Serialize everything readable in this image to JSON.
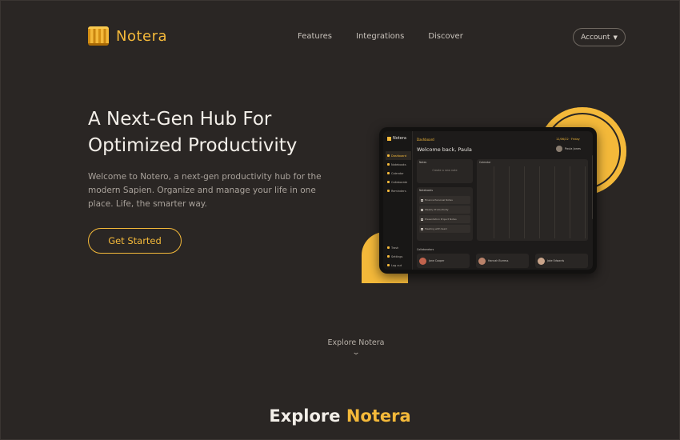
{
  "nav": {
    "brand": "Notera",
    "links": [
      "Features",
      "Integrations",
      "Discover"
    ],
    "account_label": "Account"
  },
  "hero": {
    "title_line1": "A Next-Gen Hub For",
    "title_line2": "Optimized Productivity",
    "description": "Welcome to Notero, a next-gen productivity hub for the modern Sapien. Organize and manage your life in one place. Life, the smarter way.",
    "cta_label": "Get Started"
  },
  "mockup": {
    "brand": "Notera",
    "crumb": "Dashboard",
    "welcome": "Welcome back, Paula",
    "date": "12/06/22 · Friday",
    "user": "Paula Jones",
    "sidebar": [
      "Dashboard",
      "Notebooks",
      "Calendar",
      "Collaborate",
      "Reminders"
    ],
    "sidebar_bottom": [
      "Trash",
      "Settings",
      "Log out"
    ],
    "notes_panel_title": "Notes",
    "notes_empty": "Create a new note",
    "notebooks_title": "Notebooks",
    "notebooks": [
      "Finance Personal Notes",
      "Weekly Productivity",
      "Presentation Project Notes",
      "Meeting with team"
    ],
    "calendar_title": "Calendar",
    "collab_title": "Collaborators",
    "collaborators": [
      "Jane Cooper",
      "Hannah Burress",
      "Jake Edwards"
    ]
  },
  "explore": {
    "link_label": "Explore Notera",
    "chevron": "⌄",
    "section_title_prefix": "Explore",
    "section_title_accent": "Notera"
  },
  "colors": {
    "background": "#2a2624",
    "accent": "#f4b93a",
    "text": "#f3efe9",
    "muted": "#a9a29b"
  }
}
